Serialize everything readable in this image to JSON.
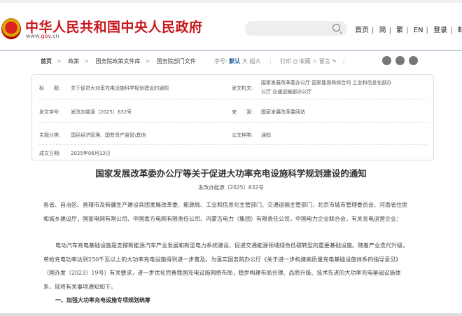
{
  "header": {
    "site_title": "中华人民共和国中央人民政府",
    "site_url_prefix": "www.",
    "site_url_brand": "gov",
    "site_url_suffix": ".cn",
    "search_placeholder": "",
    "links": [
      "首页",
      "简",
      "繁",
      "EN",
      "登录",
      "邮箱"
    ]
  },
  "breadcrumb": [
    "首页",
    "政策",
    "国务院政策文件库",
    "国务院部门文件"
  ],
  "toolbar": {
    "font_label": "字号:",
    "font_default": "默认",
    "font_large": "大",
    "font_xlarge": "超大",
    "print": "打印",
    "favorite": "收藏",
    "comment": "留言",
    "social_icons": [
      "weibo-icon",
      "wechat-icon",
      "qzone-icon"
    ]
  },
  "info": {
    "title_label": "标　　题:",
    "title_value": "关于促进大功率充电设施科学规划建设的通知",
    "issuer_label": "发文机关:",
    "issuer_value_1": "国家发展改革委办公厅 国家能源局综合司 工业和信息化部办",
    "issuer_value_2": "公厅 交通运输部办公厅",
    "docno_label": "发文字号:",
    "docno_value": "发改办能源〔2025〕632号",
    "source_label": "来　　源:",
    "source_value": "国家发展改革委网站",
    "topic_label": "主题分类:",
    "topic_value": "国民经济管理、国有资产监管\\其他",
    "type_label": "公文种类:",
    "type_value": "通知",
    "date_label": "成文日期:",
    "date_value": "2025年06月13日"
  },
  "document": {
    "title": "国家发展改革委办公厅等关于促进大功率充电设施科学规划建设的通知",
    "number": "发改办能源〔2025〕632号",
    "addressees": "各省、自治区、直辖市及新疆生产建设兵团发展改革委、能源局、工业和信息化主管部门、交通运输主管部门，北京市城市管理委员会、河南省住房和城乡建设厅，国家电网有限公司、中国南方电网有限责任公司、内蒙古电力（集团）有限责任公司，中国电力企业联合会，有关充电运营企业：",
    "paragraph_1": "电动汽车充电基础设施是支撑新能源汽车产业发展和新型电力系统建设、促进交通能源领域绿色低碳转型的重要基础设施。随着产业迭代升级，单枪充电功率达到250千瓦以上的大功率充电设施得到进一步普及。为落实国务院办公厅《关于进一步构建高质量充电基础设施体系的指导意见》（国办发〔2023〕19号）有关要求，进一步优化完善我国充电设施网络布局，稳步构建布局合理、品质升级、技术先进的大功率充电基础设施体系，现将有关事项通知如下。",
    "section_1": "一、加强大功率充电设施专项规划统筹"
  }
}
